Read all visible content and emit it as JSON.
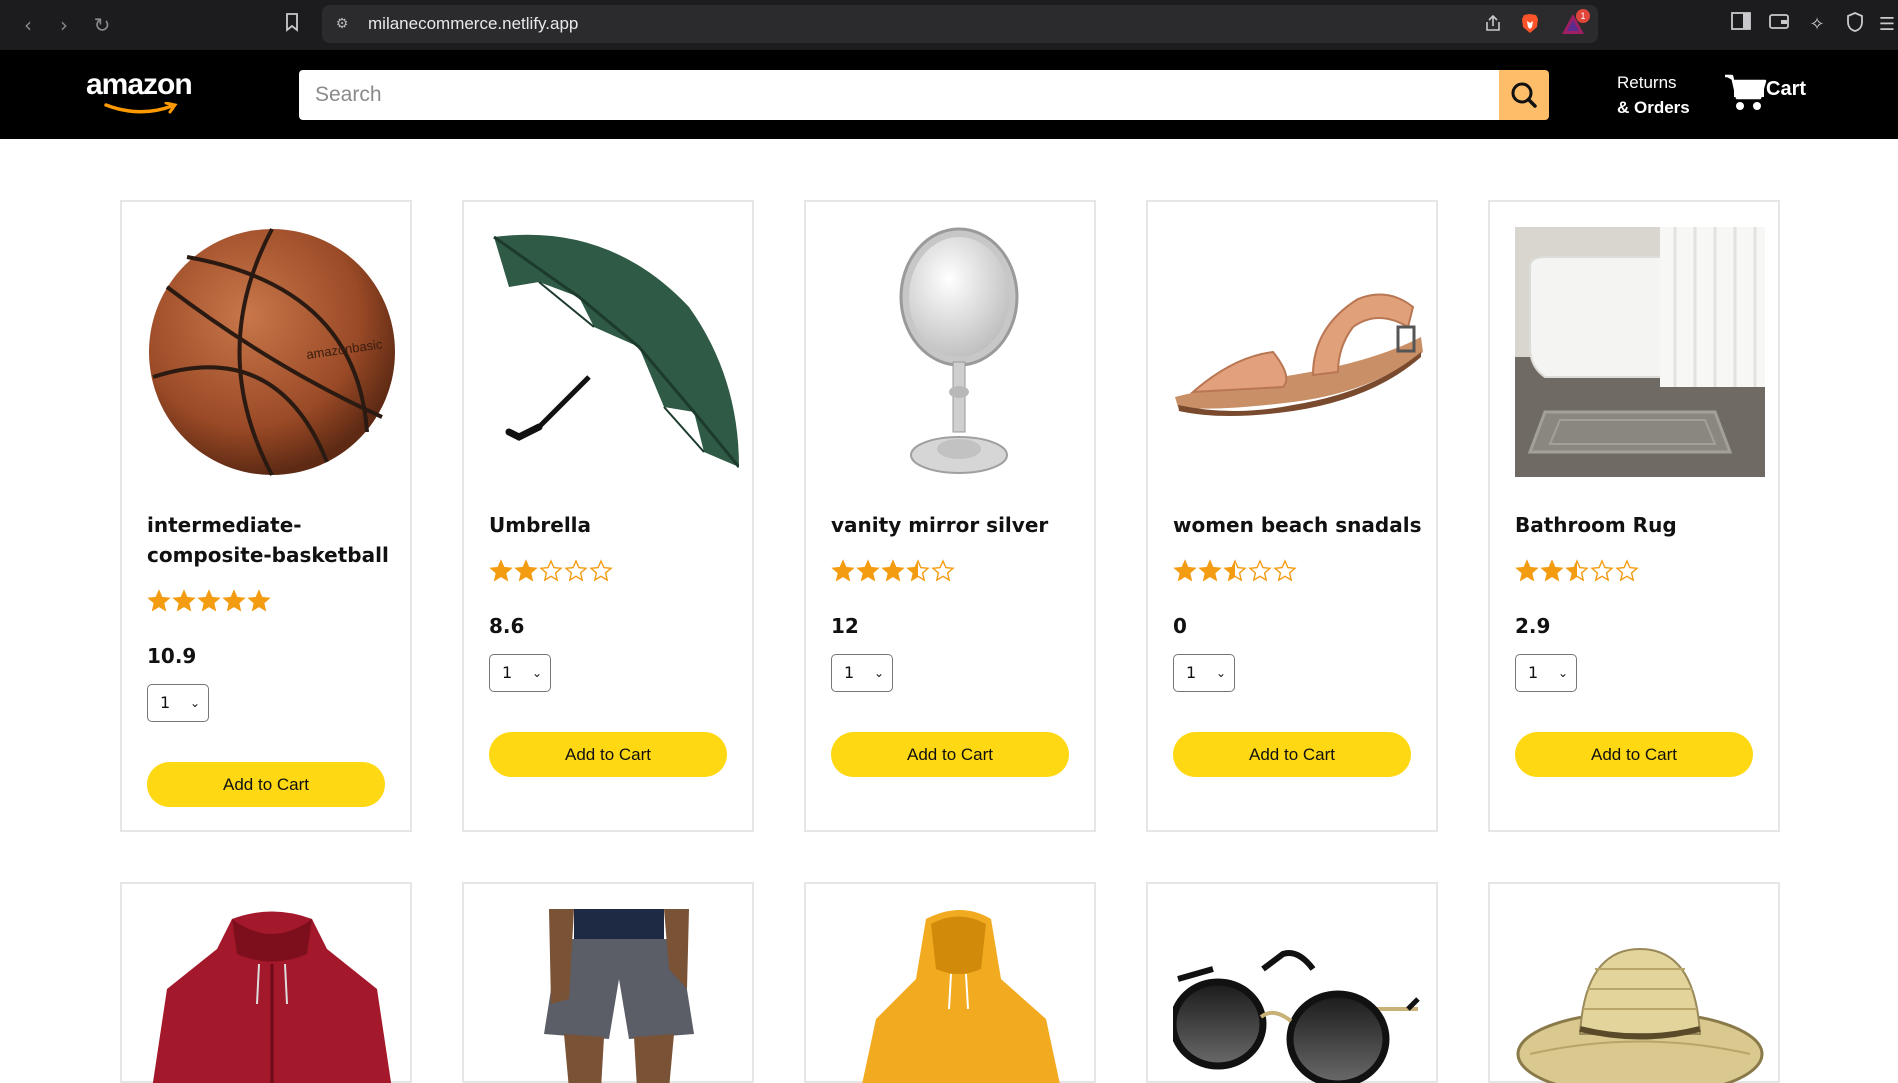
{
  "browser": {
    "url": "milanecommerce.netlify.app",
    "notification_count": "1"
  },
  "header": {
    "logo_text": "amazon",
    "search_placeholder": "Search",
    "returns_line1": "Returns",
    "returns_line2": "& Orders",
    "cart_label": "Cart"
  },
  "colors": {
    "header_bg": "#000000",
    "search_button": "#febd69",
    "add_button": "#ffd814",
    "star": "#f39c12"
  },
  "products": [
    {
      "title": "intermediate-composite-basketball",
      "rating": 5,
      "price": "10.9",
      "qty": "1",
      "button": "Add to Cart",
      "image": "basketball"
    },
    {
      "title": "Umbrella",
      "rating": 2,
      "price": "8.6",
      "qty": "1",
      "button": "Add to Cart",
      "image": "umbrella"
    },
    {
      "title": "vanity mirror silver",
      "rating": 3.5,
      "price": "12",
      "qty": "1",
      "button": "Add to Cart",
      "image": "mirror"
    },
    {
      "title": "women beach snadals",
      "rating": 2.5,
      "price": "0",
      "qty": "1",
      "button": "Add to Cart",
      "image": "sandals"
    },
    {
      "title": "Bathroom Rug",
      "rating": 2.5,
      "price": "2.9",
      "qty": "1",
      "button": "Add to Cart",
      "image": "rug"
    }
  ],
  "products_row2": [
    {
      "image": "red-hoodie"
    },
    {
      "image": "shorts"
    },
    {
      "image": "yellow-hoodie"
    },
    {
      "image": "sunglasses"
    },
    {
      "image": "straw-hat"
    }
  ]
}
